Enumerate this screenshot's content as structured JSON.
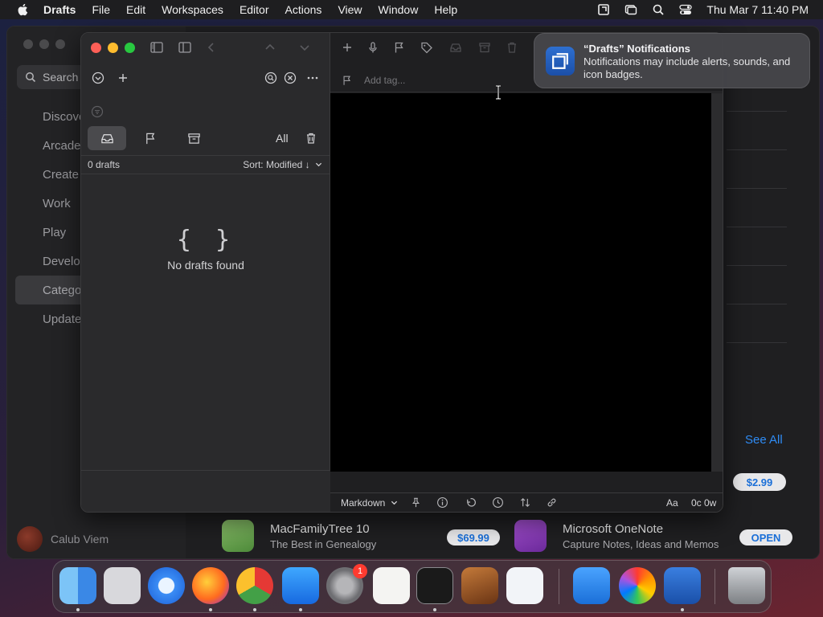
{
  "menubar": {
    "app_name": "Drafts",
    "items": [
      "File",
      "Edit",
      "Workspaces",
      "Editor",
      "Actions",
      "View",
      "Window",
      "Help"
    ],
    "clock": "Thu Mar 7  11:40 PM"
  },
  "appstore": {
    "search_label": "Search",
    "nav": [
      "Discover",
      "Arcade",
      "Create",
      "Work",
      "Play",
      "Develop",
      "Categories",
      "Updates"
    ],
    "active_nav": "Categories",
    "user_name": "Calub Viem",
    "see_all": "See All",
    "right_price": "$2.99",
    "apps": [
      {
        "name": "MacFamilyTree 10",
        "subtitle": "The Best in Genealogy",
        "action": "$69.99"
      },
      {
        "name": "Microsoft OneNote",
        "subtitle": "Capture Notes, Ideas and Memos",
        "action": "OPEN"
      }
    ]
  },
  "drafts": {
    "filter_all": "All",
    "count": "0 drafts",
    "sort": "Sort: Modified ↓",
    "empty_icon": "{ }",
    "empty_message": "No drafts found",
    "tag_placeholder": "Add tag...",
    "syntax": "Markdown",
    "text_size": "Aa",
    "word_count": "0c 0w"
  },
  "notification": {
    "title": "“Drafts” Notifications",
    "body": "Notifications may include alerts, sounds, and icon badges."
  },
  "dock": {
    "badge_count": "1",
    "apps": [
      "finder-icon",
      "launchpad-icon",
      "safari-icon",
      "firefox-icon",
      "chrome-icon",
      "app-store-icon",
      "system-settings-icon",
      "textedit-icon",
      "terminal-icon",
      "garageband-icon",
      "vscode-icon",
      "keynote-icon",
      "color-app-icon",
      "drafts-icon",
      "trash-icon"
    ]
  },
  "colors": {
    "accent_blue": "#2f8cf5",
    "close": "#fe5f57",
    "minimize": "#febc2e",
    "zoom": "#28c840",
    "badge": "#ff3b30"
  }
}
